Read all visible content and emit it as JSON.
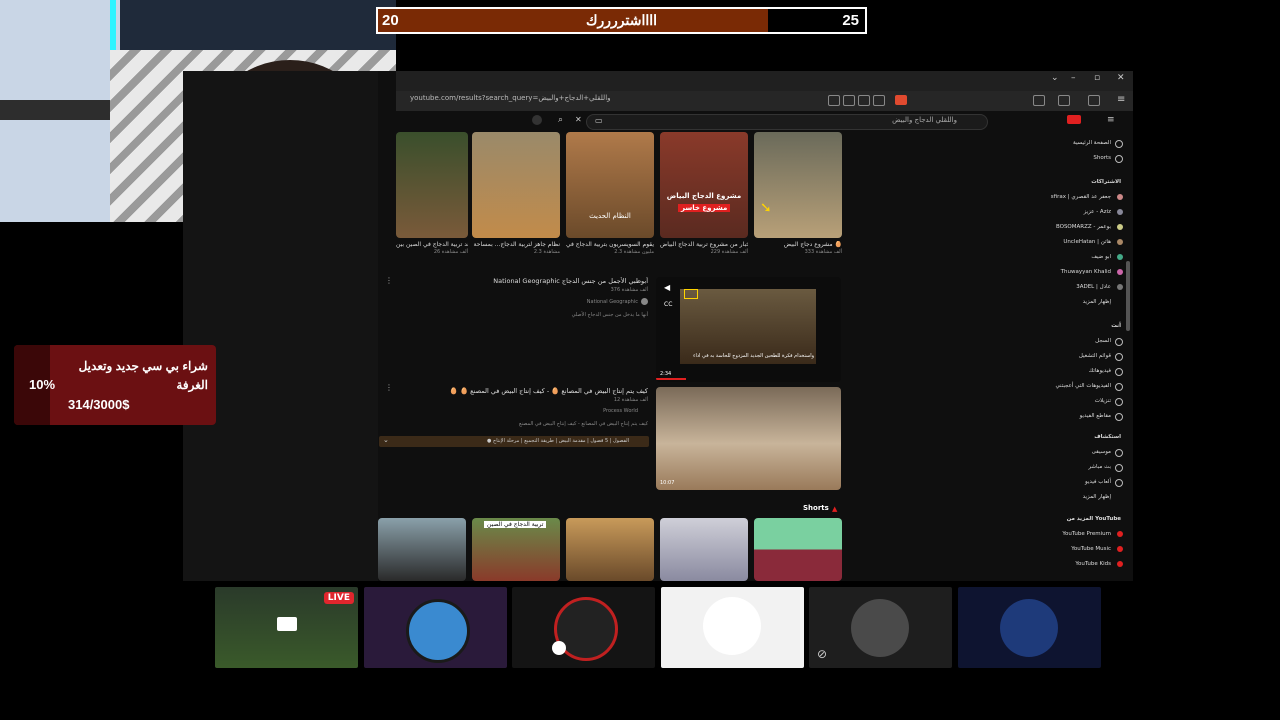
{
  "sub_goal": {
    "current": "20",
    "target": "25",
    "title": "ااااشتررررك",
    "progress": 0.8,
    "fill_color": "#7a2a05"
  },
  "browser": {
    "url": "youtube.com/results?search_query=واللقلي+الدجاج+والبيض",
    "search_query": "واللقلي الدجاج والبيض",
    "top_videos": [
      {
        "title": "شاهد تربية الدجاج في الصين بين",
        "meta": "26 ألف مشاهدة"
      },
      {
        "title": "نظام جاهز لتربية الدجاج... بمساحة",
        "meta": "2.3 مشاهدة"
      },
      {
        "title": "لماذا يقوم السويسريون بتربية الدجاج في",
        "meta": "2.3 مليون مشاهدة"
      },
      {
        "title": "أخبار من مشروع تربية الدجاج البياض",
        "meta": "229 ألف مشاهدة"
      },
      {
        "title": "مشروع دجاج البيض 🥚",
        "meta": "333 ألف مشاهدة"
      }
    ],
    "thumb_overlay_1": "النظام الحديث",
    "thumb_overlay_2a": "مشروع الدجاج البياض",
    "thumb_overlay_2b": "مشروع خاسر",
    "result1": {
      "title": "National Geographic أبوظبي الأجمل من جنس الدجاج",
      "meta": "376 ألف مشاهدة",
      "channel": "National Geographic",
      "desc": "أنها ما يدخل من جنس الدجاج الأصلي",
      "thumb_caption": "واستخدام فكرة للطحين الجديد المزدوج للحاسة به في أداء",
      "duration": "2:34"
    },
    "result2": {
      "title": "🥚 🥚 كيف يتم إنتاج البيض في المصانع 🥚 - كيف إنتاج البيض في المصنع",
      "meta": "12 ألف مشاهدة",
      "channel": "Process World",
      "desc": "كيف يتم إنتاج البيض في المصانع - كيف إنتاج البيض في المصنع",
      "chapters": "● الفصول | 5 فصول | مقدمة البيض | طريقة التجميع | مرحلة الإنتاج",
      "duration": "10:07"
    },
    "shorts_label": "Shorts",
    "shorts_overlay": "تربية الدجاج في الصين"
  },
  "sidebar": {
    "items": [
      "الصفحة الرئيسية",
      "Shorts"
    ],
    "subs_header": "الاشتراكات",
    "subscriptions": [
      "sfirax | جعفر عد القصري",
      "عزيز - Aziz",
      "BOSOMARZZ - بوعمر",
      "UncleHatan | هاتن",
      "ابو ضيف",
      "Thuwayyan Khalid",
      "3ADEL | عادل"
    ],
    "show_more": "إظهار المزيد",
    "you_header": "أنت",
    "you_items": [
      "السجل",
      "قوائم التشغيل",
      "فيديوهاتك",
      "الفيديوهات التي أعجبتني",
      "تنزيلات",
      "مقاطع الفيديو"
    ],
    "explore_header": "استكشاف",
    "explore_items": [
      "موسيقى",
      "بث مباشر",
      "ألعاب فيديو",
      "إظهار المزيد"
    ],
    "more_header": "المزيد من YouTube",
    "more_items": [
      "YouTube Premium",
      "YouTube Music",
      "YouTube Kids"
    ]
  },
  "donation": {
    "percent": "10%",
    "title": "شراء بي سي جديد وتعديل الغرفة",
    "amount": "314/3000$"
  },
  "participants": {
    "live_label": "LIVE"
  }
}
